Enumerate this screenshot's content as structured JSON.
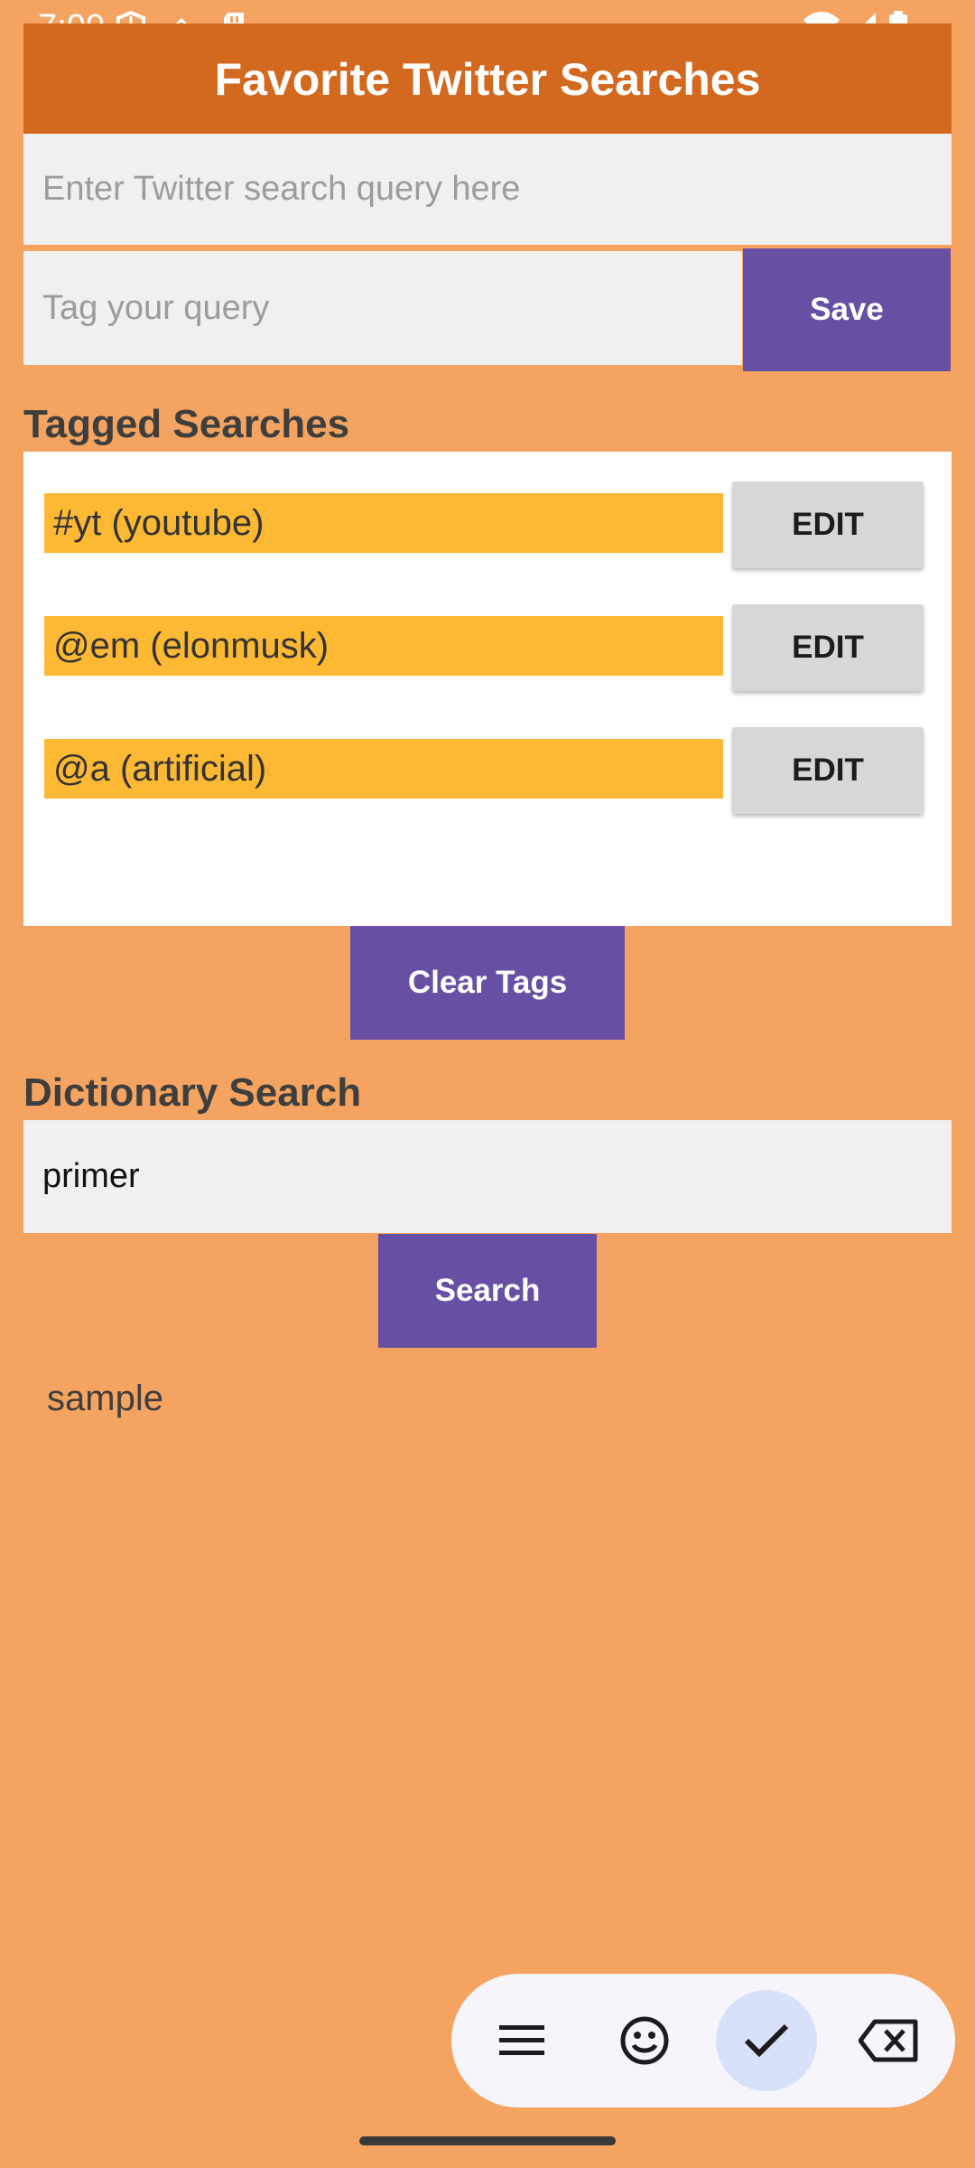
{
  "status_bar": {
    "time": "7:00"
  },
  "header": {
    "title": "Favorite Twitter Searches"
  },
  "query_input": {
    "placeholder": "Enter Twitter search query here",
    "value": ""
  },
  "tag_input": {
    "placeholder": "Tag your query",
    "value": ""
  },
  "save_label": "Save",
  "tagged_searches": {
    "title": "Tagged Searches",
    "items": [
      {
        "label": "#yt (youtube)",
        "edit_label": "EDIT"
      },
      {
        "label": "@em (elonmusk)",
        "edit_label": "EDIT"
      },
      {
        "label": "@a (artificial)",
        "edit_label": "EDIT"
      }
    ]
  },
  "clear_tags_label": "Clear Tags",
  "dictionary": {
    "title": "Dictionary Search",
    "input_value": "primer",
    "search_label": "Search",
    "result": "sample"
  },
  "colors": {
    "background": "#F4A460",
    "header": "#D2691E",
    "button": "#6750A4",
    "tag_label": "#FDB934"
  },
  "keyboard_toolbar": {
    "icons": [
      "menu-icon",
      "emoji-icon",
      "checkmark-icon",
      "backspace-icon"
    ]
  }
}
